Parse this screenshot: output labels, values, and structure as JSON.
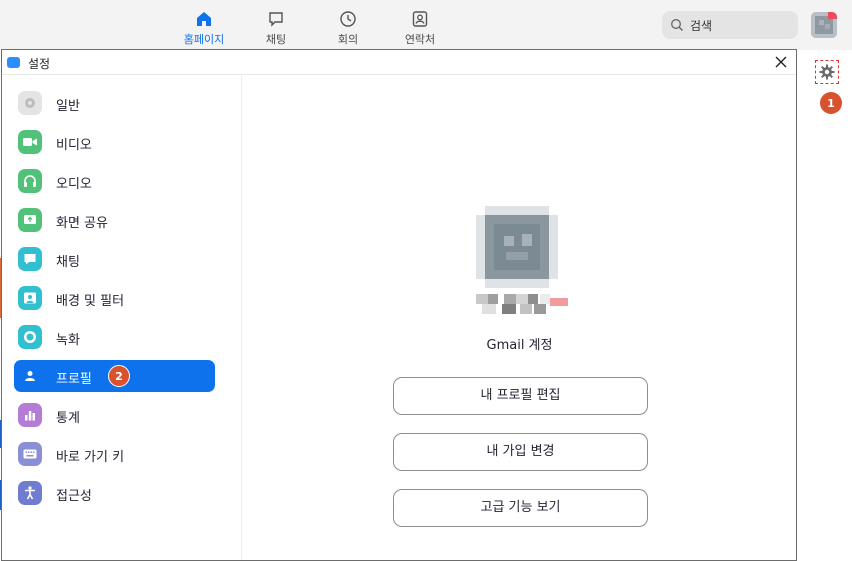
{
  "topbar": {
    "nav": [
      {
        "label": "홈페이지",
        "icon": "home-icon",
        "active": true
      },
      {
        "label": "채팅",
        "icon": "chat-icon"
      },
      {
        "label": "회의",
        "icon": "clock-icon"
      },
      {
        "label": "연락처",
        "icon": "contact-icon"
      }
    ],
    "search_label": "검색"
  },
  "badges": {
    "gear": "1",
    "profile": "2"
  },
  "window": {
    "title": "설정"
  },
  "sidebar": {
    "items": [
      {
        "label": "일반",
        "icon": "gear-icon",
        "color": "#d8d8d8"
      },
      {
        "label": "비디오",
        "icon": "video-icon",
        "color": "#52c27b"
      },
      {
        "label": "오디오",
        "icon": "headphones-icon",
        "color": "#52c27b"
      },
      {
        "label": "화면 공유",
        "icon": "share-screen-icon",
        "color": "#52c27b"
      },
      {
        "label": "채팅",
        "icon": "chat-bubble-icon",
        "color": "#31c0cf"
      },
      {
        "label": "배경 및 필터",
        "icon": "background-icon",
        "color": "#31c0cf"
      },
      {
        "label": "녹화",
        "icon": "record-icon",
        "color": "#31c0cf"
      },
      {
        "label": "프로필",
        "icon": "person-icon",
        "color": "#0e72ed",
        "active": true
      },
      {
        "label": "통계",
        "icon": "stats-icon",
        "color": "#b57cd6"
      },
      {
        "label": "바로 가기 키",
        "icon": "keyboard-icon",
        "color": "#8a8fd6"
      },
      {
        "label": "접근성",
        "icon": "accessibility-icon",
        "color": "#6f7ccf"
      }
    ]
  },
  "profile": {
    "account_label": "Gmail 계정",
    "buttons": {
      "edit": "내 프로필 편집",
      "plan": "내 가입 변경",
      "advanced": "고급 기능 보기"
    }
  },
  "colors": {
    "accent": "#0e72ed",
    "badge": "#d9522e"
  }
}
